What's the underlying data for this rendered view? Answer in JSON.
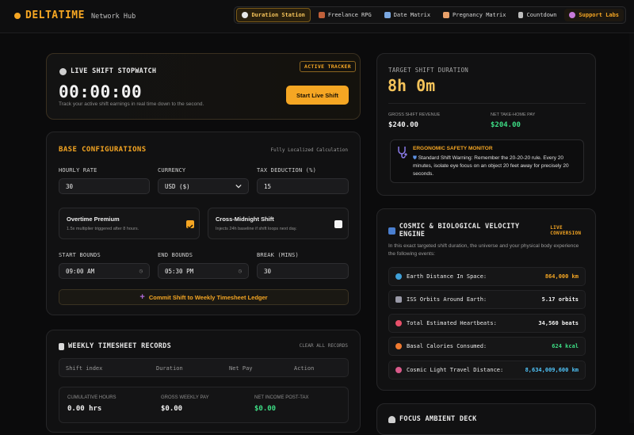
{
  "header": {
    "brand": "DELTATIME",
    "brand_sub": "Network Hub",
    "nav": [
      {
        "label": "Duration Station",
        "icon": "clock-icon"
      },
      {
        "label": "Freelance RPG",
        "icon": "briefcase-icon"
      },
      {
        "label": "Date Matrix",
        "icon": "calendar-icon"
      },
      {
        "label": "Pregnancy Matrix",
        "icon": "heart-icon"
      },
      {
        "label": "Countdown",
        "icon": "hourglass-icon"
      },
      {
        "label": "Support Labs",
        "icon": "flask-icon"
      }
    ]
  },
  "stopwatch": {
    "title": "LIVE SHIFT STOPWATCH",
    "badge": "ACTIVE TRACKER",
    "time": "00:00:00",
    "desc": "Track your active shift earnings in real time down to the second.",
    "start_label": "Start Live Shift"
  },
  "config": {
    "title": "BASE CONFIGURATIONS",
    "note": "Fully Localized Calculation",
    "hourly_rate_label": "HOURLY RATE",
    "hourly_rate": "30",
    "currency_label": "CURRENCY",
    "currency": "USD ($)",
    "tax_label": "TAX DEDUCTION (%)",
    "tax": "15",
    "overtime_title": "Overtime Premium",
    "overtime_desc": "1.5x multiplier triggered after 8 hours.",
    "midnight_title": "Cross-Midnight Shift",
    "midnight_desc": "Injects 24h baseline if shift loops next day.",
    "start_label": "START BOUNDS",
    "start": "09:00 AM",
    "end_label": "END BOUNDS",
    "end": "05:30 PM",
    "break_label": "BREAK (MINS)",
    "break": "30",
    "commit_label": "Commit Shift to Weekly Timesheet Ledger"
  },
  "timesheet": {
    "title": "WEEKLY TIMESHEET RECORDS",
    "clear_label": "CLEAR ALL RECORDS",
    "columns": [
      "Shift index",
      "Duration",
      "Net Pay",
      "Action"
    ],
    "cum_hours_label": "CUMULATIVE HOURS",
    "cum_hours": "0.00 hrs",
    "gross_label": "GROSS WEEKLY PAY",
    "gross": "$0.00",
    "net_label": "NET INCOME POST-TAX",
    "net": "$0.00"
  },
  "target": {
    "label": "TARGET SHIFT DURATION",
    "value": "8h 0m",
    "gross_label": "GROSS SHIFT REVENUE",
    "gross": "$240.00",
    "net_label": "NET TAKE-HOME PAY",
    "net": "$204.00",
    "monitor_title": "ERGONOMIC SAFETY MONITOR",
    "monitor_text": "Standard Shift Warning: Remember the 20-20-20 rule. Every 20 minutes, isolate eye focus on an object 20 feet away for precisely 20 seconds."
  },
  "cosmic": {
    "title": "COSMIC & BIOLOGICAL VELOCITY ENGINE",
    "live": "LIVE CONVERSION",
    "intro": "In this exact targeted shift duration, the universe and your physical body experience the following events:",
    "rows": [
      {
        "label": "Earth Distance In Space:",
        "value": "864,000 km",
        "color": "#f5a623",
        "icon": "globe-icon"
      },
      {
        "label": "ISS Orbits Around Earth:",
        "value": "5.17 orbits",
        "color": "#f0f0f0",
        "icon": "satellite-icon"
      },
      {
        "label": "Total Estimated Heartbeats:",
        "value": "34,560 beats",
        "color": "#f0f0f0",
        "icon": "heart-icon"
      },
      {
        "label": "Basal Calories Consumed:",
        "value": "624 kcal",
        "color": "#3ddc84",
        "icon": "flame-icon"
      },
      {
        "label": "Cosmic Light Travel Distance:",
        "value": "8,634,009,600 km",
        "color": "#4fc3f7",
        "icon": "rocket-icon"
      }
    ]
  },
  "focus": {
    "title": "FOCUS AMBIENT DECK"
  },
  "colors": {
    "accent": "#f5a623",
    "green": "#3ddc84",
    "cyan": "#4fc3f7"
  }
}
